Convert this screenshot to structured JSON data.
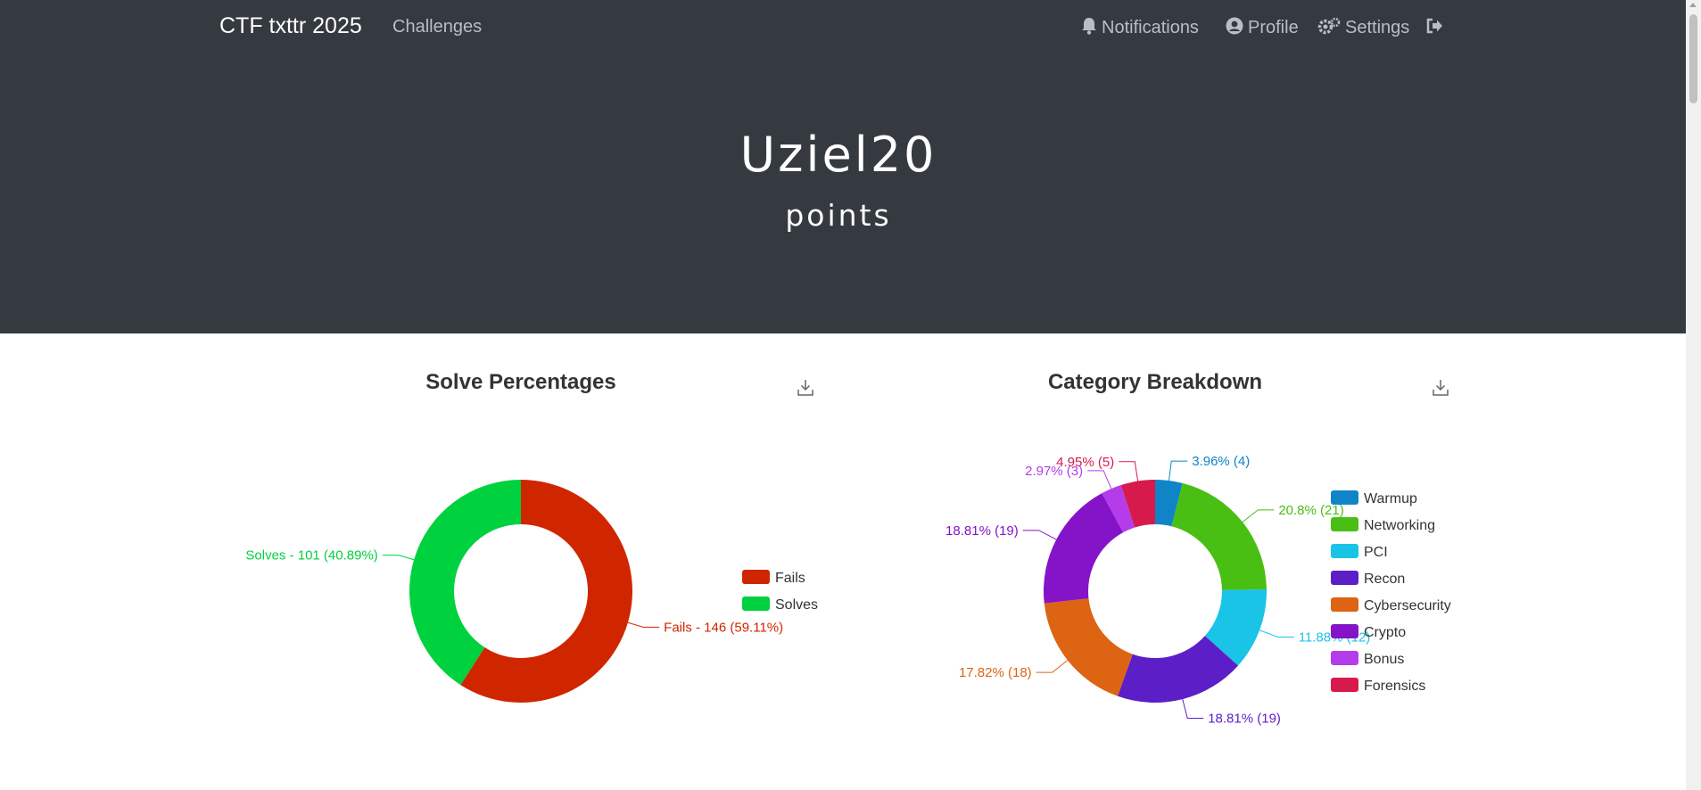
{
  "navbar": {
    "brand": "CTF txttr 2025",
    "challenges": "Challenges",
    "notifications": "Notifications",
    "profile": "Profile",
    "settings": "Settings",
    "logout_icon": "sign-out-icon"
  },
  "header": {
    "team_name": "Uziel20",
    "points_label": "points"
  },
  "colors": {
    "navbar_bg": "#343a40",
    "fails": "#cf2600",
    "solves": "#00d13f"
  },
  "chart_data": [
    {
      "type": "pie",
      "title": "Solve Percentages",
      "slices": [
        {
          "name": "Fails",
          "value": 146,
          "label": "Fails - 146 (59.11%)",
          "color": "#cf2600"
        },
        {
          "name": "Solves",
          "value": 101,
          "label": "Solves - 101 (40.89%)",
          "color": "#00d13f"
        }
      ],
      "legend": [
        "Fails",
        "Solves"
      ],
      "legend_position": "right"
    },
    {
      "type": "pie",
      "title": "Category Breakdown",
      "slices": [
        {
          "name": "Warmup",
          "value": 4,
          "label": "3.96% (4)",
          "color": "#0f85c8"
        },
        {
          "name": "Networking",
          "value": 21,
          "label": "20.8% (21)",
          "color": "#49bf14"
        },
        {
          "name": "PCI",
          "value": 12,
          "label": "11.88% (12)",
          "color": "#19c4e7"
        },
        {
          "name": "Recon",
          "value": 19,
          "label": "18.81% (19)",
          "color": "#5c1ec7"
        },
        {
          "name": "Cybersecurity",
          "value": 18,
          "label": "17.82% (18)",
          "color": "#dc6412"
        },
        {
          "name": "Crypto",
          "value": 19,
          "label": "18.81% (19)",
          "color": "#8513c8"
        },
        {
          "name": "Bonus",
          "value": 3,
          "label": "2.97% (3)",
          "color": "#b43ceb"
        },
        {
          "name": "Forensics",
          "value": 5,
          "label": "4.95% (5)",
          "color": "#d71a4c"
        }
      ],
      "legend": [
        "Warmup",
        "Networking",
        "PCI",
        "Recon",
        "Cybersecurity",
        "Crypto",
        "Bonus",
        "Forensics"
      ],
      "legend_position": "right"
    }
  ]
}
